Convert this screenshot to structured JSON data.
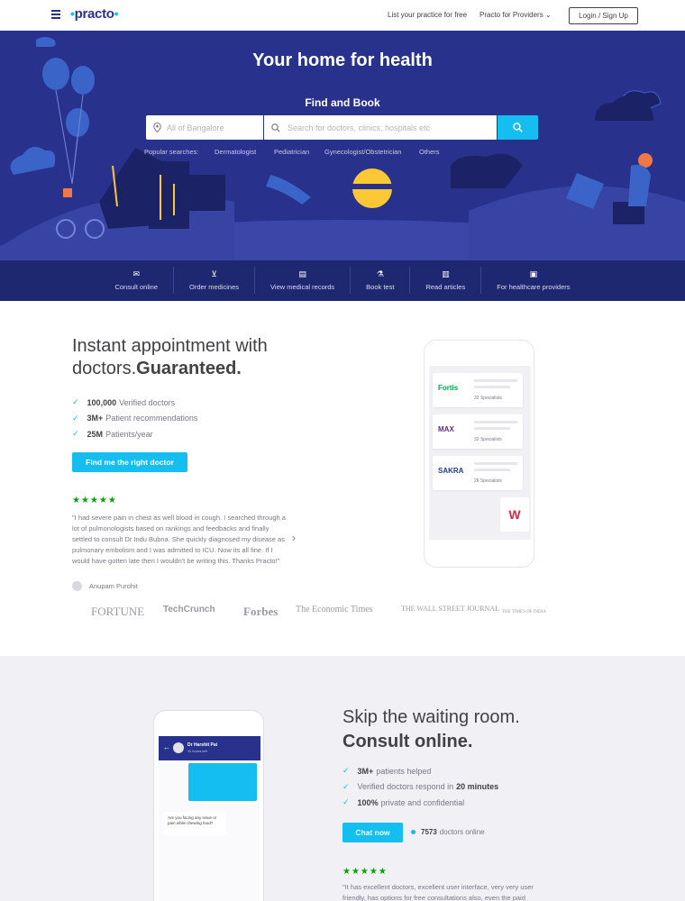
{
  "header": {
    "logo": "practo",
    "links": [
      "List your practice for free",
      "Practo for Providers"
    ],
    "login": "Login / Sign Up"
  },
  "hero": {
    "title": "Your home for health",
    "subtitle": "Find and Book",
    "location_placeholder": "All of Bangalore",
    "search_placeholder": "Search for doctors, clinics, hospitals etc",
    "popular_label": "Popular searches:",
    "popular": [
      "Dermatologist",
      "Pediatrician",
      "Gynecologist/Obstetrician",
      "Others"
    ]
  },
  "nav": [
    {
      "label": "Consult online",
      "icon": "chat-icon"
    },
    {
      "label": "Order medicines",
      "icon": "cart-icon"
    },
    {
      "label": "View medical records",
      "icon": "records-icon"
    },
    {
      "label": "Book test",
      "icon": "flask-icon"
    },
    {
      "label": "Read articles",
      "icon": "book-icon"
    },
    {
      "label": "For healthcare providers",
      "icon": "briefcase-icon"
    }
  ],
  "section1": {
    "heading_line1": "Instant appointment with",
    "heading_line2_prefix": "doctors.",
    "heading_line2_bold": "Guaranteed.",
    "checks": [
      {
        "bold": "100,000",
        "rest": "Verified doctors"
      },
      {
        "bold": "3M+",
        "rest": "Patient recommendations"
      },
      {
        "bold": "25M",
        "rest": "Patients/year"
      }
    ],
    "cta": "Find me the right doctor",
    "stars": "★★★★★",
    "review": "\"I had severe pain in chest as well blood in cough. I searched through a lot of pulmonologists based on rankings and feedbacks and finally settled to consult Dr Indu Bubna. She quickly diagnosed my disease as pulmonary embolism and I was admitted to ICU. Now its all fine. If I would have gotten late then I wouldn't be writing this. Thanks Practo!\"",
    "reviewer": "Anupam Purohit",
    "press": [
      "FORTUNE",
      "TechCrunch",
      "Forbes",
      "The Economic Times",
      "THE WALL STREET JOURNAL",
      "THE TIMES OF INDIA"
    ],
    "hospitals": [
      {
        "name": "Fortis",
        "specialists": "32 Specialists",
        "color": "#00a651"
      },
      {
        "name": "MAX",
        "specialists": "32 Specialists",
        "color": "#5a2d82"
      },
      {
        "name": "SAKRA",
        "specialists": "26 Specialists",
        "color": "#1e3c8c"
      }
    ]
  },
  "section2": {
    "heading_line1": "Skip the waiting room.",
    "heading_line2": "Consult online.",
    "checks": [
      {
        "bold": "3M+",
        "rest": "patients helped"
      },
      {
        "pre": "Verified doctors respond in",
        "bold": "20 minutes"
      },
      {
        "bold": "100%",
        "rest": "private and confidential"
      }
    ],
    "cta": "Chat now",
    "online_count": "7573",
    "online_label": "doctors online",
    "stars": "★★★★★",
    "review": "\"It has excellent doctors, excellent user interface, very very user friendly, has options for free consultations also, even the paid",
    "chat": {
      "doctor": "Dr Harshit Pai",
      "status": "11 hours left",
      "question": "Are you facing any issue or pain while chewing food?"
    }
  }
}
